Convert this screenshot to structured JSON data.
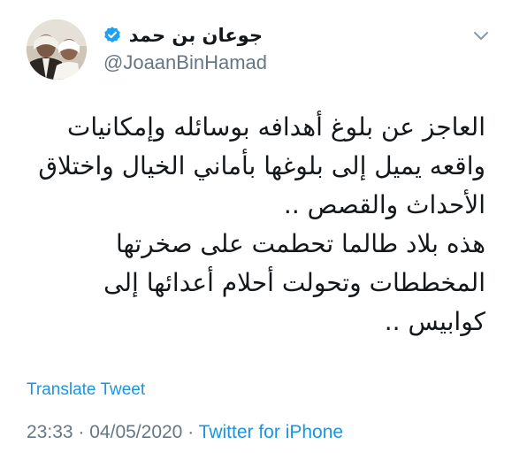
{
  "author": {
    "display_name": "جوعان بن حمد",
    "handle": "@JoaanBinHamad",
    "verified": true
  },
  "tweet": {
    "lines": [
      "العاجز عن بلوغ أهدافه بوسائله وإمكانيات",
      "واقعه يميل إلى بلوغها بأماني الخيال واختلاق",
      "الأحداث والقصص ..",
      "هذه بلاد طالما تحطمت على صخرتها",
      "المخططات وتحولت أحلام أعدائها إلى",
      "كوابيس .."
    ]
  },
  "translate_label": "Translate Tweet",
  "meta": {
    "time": "23:33",
    "separator": "·",
    "date": "04/05/2020",
    "source": "Twitter for iPhone"
  },
  "icons": {
    "verified": "verified-badge-icon",
    "menu": "chevron-down-icon"
  },
  "colors": {
    "link": "#1b95e0",
    "secondary_text": "#657786",
    "primary_text": "#14171a",
    "verified": "#1da1f2"
  }
}
